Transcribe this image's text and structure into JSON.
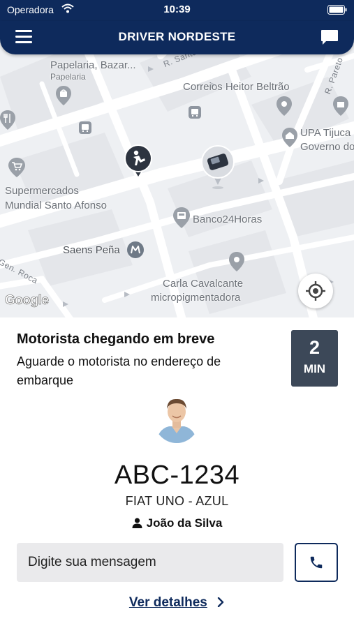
{
  "status_bar": {
    "carrier": "Operadora",
    "time": "10:39"
  },
  "header": {
    "title": "DRIVER NORDESTE",
    "menu_icon": "hamburger-icon",
    "chat_icon": "chat-bubble-icon"
  },
  "map": {
    "labels": {
      "papelaria": "Papelaria, Bazar...",
      "papelaria_cat": "Papelaria",
      "street_santa": "R. Santa S",
      "street_pareto": "R. Pareto",
      "correios": "Correios Heitor Beltrão",
      "upa_1": "UPA Tijuca",
      "upa_2": "Governo do",
      "supermercados_1": "Supermercados",
      "supermercados_2": "Mundial Santo Afonso",
      "banco": "Banco24Horas",
      "saens": "Saens Peña",
      "gen_roca": "Gen. Roca",
      "carla_1": "Carla Cavalcante",
      "carla_2": "micropigmentadora",
      "google": "Google"
    }
  },
  "trip": {
    "status_title": "Motorista chegando em breve",
    "status_subtitle": "Aguarde o motorista no endereço de embarque",
    "eta_value": "2",
    "eta_unit": "MIN",
    "plate": "ABC-1234",
    "car": "FIAT UNO - AZUL",
    "driver_name": "João da Silva"
  },
  "message": {
    "placeholder": "Digite sua mensagem"
  },
  "details_link": "Ver detalhes",
  "colors": {
    "navy": "#0e2a5c",
    "eta_box": "#3c4858",
    "input_bg": "#eaeaec",
    "map_bg": "#eef0f3"
  }
}
